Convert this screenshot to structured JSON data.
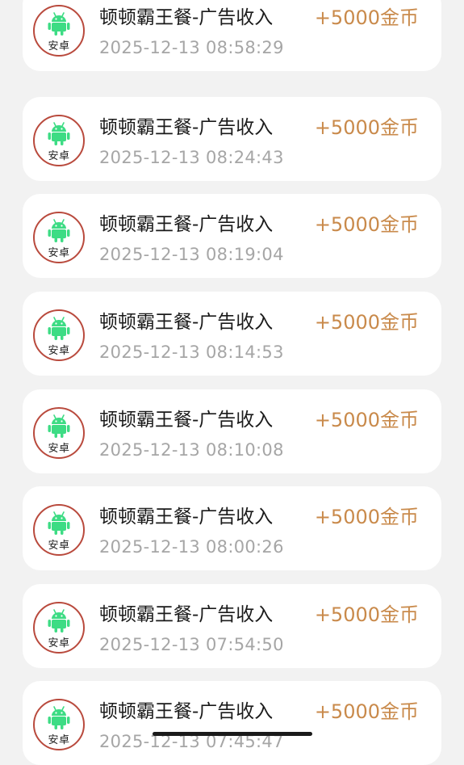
{
  "records": [
    {
      "platform": "安卓",
      "title": "顿顿霸王餐-广告收入",
      "amount": "+5000金币",
      "time": "2025-12-13 08:58:29"
    },
    {
      "platform": "安卓",
      "title": "顿顿霸王餐-广告收入",
      "amount": "+5000金币",
      "time": "2025-12-13 08:24:43"
    },
    {
      "platform": "安卓",
      "title": "顿顿霸王餐-广告收入",
      "amount": "+5000金币",
      "time": "2025-12-13 08:19:04"
    },
    {
      "platform": "安卓",
      "title": "顿顿霸王餐-广告收入",
      "amount": "+5000金币",
      "time": "2025-12-13 08:14:53"
    },
    {
      "platform": "安卓",
      "title": "顿顿霸王餐-广告收入",
      "amount": "+5000金币",
      "time": "2025-12-13 08:10:08"
    },
    {
      "platform": "安卓",
      "title": "顿顿霸王餐-广告收入",
      "amount": "+5000金币",
      "time": "2025-12-13 08:00:26"
    },
    {
      "platform": "安卓",
      "title": "顿顿霸王餐-广告收入",
      "amount": "+5000金币",
      "time": "2025-12-13 07:54:50"
    },
    {
      "platform": "安卓",
      "title": "顿顿霸王餐-广告收入",
      "amount": "+5000金币",
      "time": "2025-12-13 07:45:47"
    }
  ],
  "colors": {
    "amount": "#c98a4b",
    "badge_border": "#b94a3d",
    "android_green": "#3ddc84"
  },
  "icons": {
    "platform_icon": "android-icon"
  }
}
